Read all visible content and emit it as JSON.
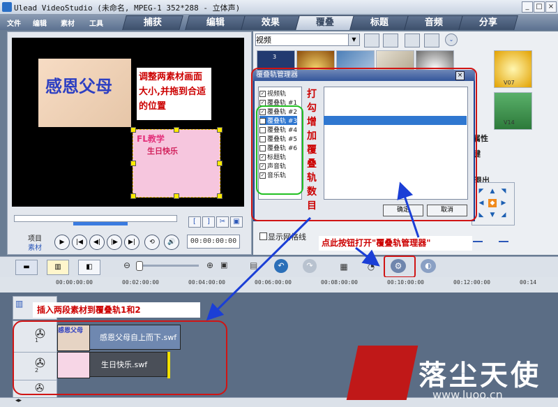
{
  "window": {
    "title": "Ulead VideoStudio (未命名, MPEG-1 352*288 - 立体声)",
    "min": "_",
    "max": "□",
    "close": "×"
  },
  "menu": [
    "文件",
    "编辑",
    "素材",
    "工具"
  ],
  "tabs": [
    {
      "label": "捕获",
      "active": false
    },
    {
      "label": "编辑",
      "active": false
    },
    {
      "label": "效果",
      "active": false
    },
    {
      "label": "覆叠",
      "active": true
    },
    {
      "label": "标题",
      "active": false
    },
    {
      "label": "音频",
      "active": false
    },
    {
      "label": "分享",
      "active": false
    }
  ],
  "preview": {
    "clip1_text": "感恩父母",
    "clip2_logo": "FL教学",
    "clip2_word": "生日快乐",
    "annotation": "调整两素材画面大小,并拖到合适的位置",
    "labels": {
      "project": "项目",
      "clip": "素材"
    },
    "trim": [
      "[",
      "]",
      "✂",
      "▣"
    ],
    "play_controls": [
      "▶",
      "|◀",
      "◀|",
      "|▶",
      "▶|",
      "⟲",
      "🔊"
    ],
    "timecode": "00:00:00:00"
  },
  "library": {
    "dropdown": "视频",
    "thumbs": [
      {
        "label": "3"
      },
      {
        "label": ""
      },
      {
        "label": ""
      },
      {
        "label": ""
      },
      {
        "label": ""
      },
      {
        "label": "V07"
      },
      {
        "label": "V14"
      }
    ]
  },
  "dialog": {
    "title": "覆叠轨管理器",
    "tracks": [
      {
        "label": "视频轨",
        "checked": true,
        "selected": false
      },
      {
        "label": "覆叠轨 #1",
        "checked": true,
        "selected": false
      },
      {
        "label": "覆叠轨 #2",
        "checked": true,
        "selected": false
      },
      {
        "label": "覆叠轨 #3",
        "checked": true,
        "selected": true
      },
      {
        "label": "覆叠轨 #4",
        "checked": false,
        "selected": false
      },
      {
        "label": "覆叠轨 #5",
        "checked": false,
        "selected": false
      },
      {
        "label": "覆叠轨 #6",
        "checked": false,
        "selected": false
      },
      {
        "label": "标题轨",
        "checked": true,
        "selected": false
      },
      {
        "label": "声音轨",
        "checked": true,
        "selected": false
      },
      {
        "label": "音乐轨",
        "checked": true,
        "selected": false
      }
    ],
    "vertical_note": [
      "打",
      "勾",
      "增",
      "加",
      "覆",
      "叠",
      "轨",
      "数",
      "目"
    ],
    "ok": "确定",
    "cancel": "取消"
  },
  "side": {
    "attr": "属性",
    "edit": "键",
    "out": "退出",
    "grid_checkbox": "显示网格线"
  },
  "annotations": {
    "top": "点此按钮打开\"覆叠轨管理器\"",
    "bottom": "插入两段素材到覆叠轨1和2"
  },
  "timeline": {
    "ticks": [
      "00:00:00:00",
      "00:02:00:00",
      "00:04:00:00",
      "00:06:00:00",
      "00:08:00:00",
      "00:10:00:00",
      "00:12:00:00",
      "00:14"
    ],
    "track_numbers": [
      "1",
      "2"
    ],
    "clips": [
      {
        "label": "感恩父母自上而下.swf",
        "thumb": "感恩父母"
      },
      {
        "label": "生日快乐.swf",
        "thumb": ""
      }
    ]
  },
  "watermark": {
    "text": "落尘天使",
    "url": "www.luoo.cn"
  },
  "colors": {
    "accent": "#2f77d0",
    "annotation_red": "#d01414",
    "arrow_blue": "#1b3fd6"
  }
}
